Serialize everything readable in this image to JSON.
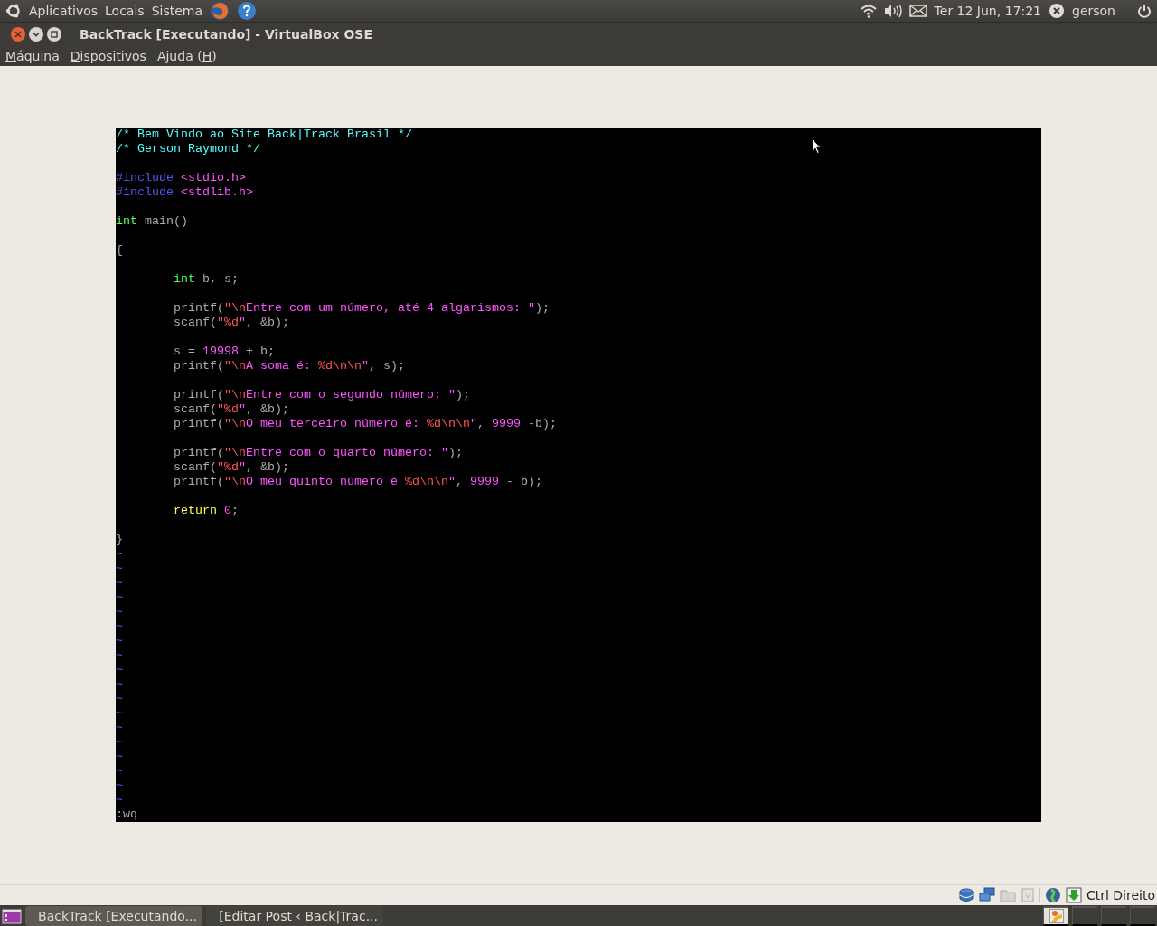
{
  "top_panel": {
    "menus": [
      "Aplicativos",
      "Locais",
      "Sistema"
    ],
    "clock": "Ter 12 Jun, 17:21",
    "user": "gerson"
  },
  "window": {
    "title": "BackTrack [Executando] - VirtualBox OSE"
  },
  "menubar": [
    {
      "mnemonic": "M",
      "rest": "áquina"
    },
    {
      "mnemonic": "D",
      "rest": "ispositivos"
    },
    {
      "before": "Ajuda (",
      "mnemonic": "H",
      "rest": ")"
    }
  ],
  "vm_screen": {
    "lines": [
      {
        "kind": "code",
        "segments": [
          {
            "kind": "comment",
            "text": "/* Bem Vindo ao Site Back|Track Brasil */"
          }
        ]
      },
      {
        "kind": "code",
        "segments": [
          {
            "kind": "comment",
            "text": "/* Gerson Raymond */"
          }
        ]
      },
      {
        "kind": "blank"
      },
      {
        "kind": "code",
        "segments": [
          {
            "kind": "preproc",
            "text": "#include "
          },
          {
            "kind": "string",
            "text": "<stdio.h>"
          }
        ]
      },
      {
        "kind": "code",
        "segments": [
          {
            "kind": "preproc",
            "text": "#include "
          },
          {
            "kind": "string",
            "text": "<stdlib.h>"
          }
        ]
      },
      {
        "kind": "blank"
      },
      {
        "kind": "code",
        "segments": [
          {
            "kind": "type",
            "text": "int"
          },
          {
            "kind": "normal",
            "text": " main()"
          }
        ]
      },
      {
        "kind": "blank"
      },
      {
        "kind": "code",
        "segments": [
          {
            "kind": "normal",
            "text": "{"
          }
        ]
      },
      {
        "kind": "blank"
      },
      {
        "kind": "code",
        "segments": [
          {
            "kind": "type",
            "text": "\tint"
          },
          {
            "kind": "normal",
            "text": " b, s;"
          }
        ]
      },
      {
        "kind": "blank"
      },
      {
        "kind": "code",
        "segments": [
          {
            "kind": "normal",
            "text": "\tprintf("
          },
          {
            "kind": "special",
            "text": "\"\\n"
          },
          {
            "kind": "string",
            "text": "Entre com um número, até 4 algarismos: \""
          },
          {
            "kind": "normal",
            "text": ");"
          }
        ]
      },
      {
        "kind": "code",
        "segments": [
          {
            "kind": "normal",
            "text": "\tscanf("
          },
          {
            "kind": "special",
            "text": "\"%d"
          },
          {
            "kind": "string",
            "text": "\""
          },
          {
            "kind": "normal",
            "text": ", &b);"
          }
        ]
      },
      {
        "kind": "blank"
      },
      {
        "kind": "code",
        "segments": [
          {
            "kind": "normal",
            "text": "\ts = "
          },
          {
            "kind": "string",
            "text": "19998"
          },
          {
            "kind": "normal",
            "text": " + b;"
          }
        ]
      },
      {
        "kind": "code",
        "segments": [
          {
            "kind": "normal",
            "text": "\tprintf("
          },
          {
            "kind": "special",
            "text": "\"\\n"
          },
          {
            "kind": "string",
            "text": "A soma é: "
          },
          {
            "kind": "special",
            "text": "%d\\n\\n"
          },
          {
            "kind": "string",
            "text": "\""
          },
          {
            "kind": "normal",
            "text": ", s);"
          }
        ]
      },
      {
        "kind": "blank"
      },
      {
        "kind": "code",
        "segments": [
          {
            "kind": "normal",
            "text": "\tprintf("
          },
          {
            "kind": "special",
            "text": "\"\\n"
          },
          {
            "kind": "string",
            "text": "Entre com o segundo número: \""
          },
          {
            "kind": "normal",
            "text": ");"
          }
        ]
      },
      {
        "kind": "code",
        "segments": [
          {
            "kind": "normal",
            "text": "\tscanf("
          },
          {
            "kind": "special",
            "text": "\"%d"
          },
          {
            "kind": "string",
            "text": "\""
          },
          {
            "kind": "normal",
            "text": ", &b);"
          }
        ]
      },
      {
        "kind": "code",
        "segments": [
          {
            "kind": "normal",
            "text": "\tprintf("
          },
          {
            "kind": "special",
            "text": "\"\\n"
          },
          {
            "kind": "string",
            "text": "O meu terceiro número é: "
          },
          {
            "kind": "special",
            "text": "%d\\n\\n"
          },
          {
            "kind": "string",
            "text": "\""
          },
          {
            "kind": "normal",
            "text": ", "
          },
          {
            "kind": "string",
            "text": "9999"
          },
          {
            "kind": "normal",
            "text": " -b);"
          }
        ]
      },
      {
        "kind": "blank"
      },
      {
        "kind": "code",
        "segments": [
          {
            "kind": "normal",
            "text": "\tprintf("
          },
          {
            "kind": "special",
            "text": "\"\\n"
          },
          {
            "kind": "string",
            "text": "Entre com o quarto número: \""
          },
          {
            "kind": "normal",
            "text": ");"
          }
        ]
      },
      {
        "kind": "code",
        "segments": [
          {
            "kind": "normal",
            "text": "\tscanf("
          },
          {
            "kind": "special",
            "text": "\"%d"
          },
          {
            "kind": "string",
            "text": "\""
          },
          {
            "kind": "normal",
            "text": ", &b);"
          }
        ]
      },
      {
        "kind": "code",
        "segments": [
          {
            "kind": "normal",
            "text": "\tprintf("
          },
          {
            "kind": "special",
            "text": "\"\\n"
          },
          {
            "kind": "string",
            "text": "O meu quinto número é "
          },
          {
            "kind": "special",
            "text": "%d\\n\\n"
          },
          {
            "kind": "string",
            "text": "\""
          },
          {
            "kind": "normal",
            "text": ", "
          },
          {
            "kind": "string",
            "text": "9999"
          },
          {
            "kind": "normal",
            "text": " - b);"
          }
        ]
      },
      {
        "kind": "blank"
      },
      {
        "kind": "code",
        "segments": [
          {
            "kind": "statement",
            "text": "\treturn"
          },
          {
            "kind": "string",
            "text": " 0"
          },
          {
            "kind": "normal",
            "text": ";"
          }
        ]
      },
      {
        "kind": "blank"
      },
      {
        "kind": "code",
        "segments": [
          {
            "kind": "normal",
            "text": "}"
          }
        ]
      },
      {
        "kind": "tilde",
        "text": "~"
      },
      {
        "kind": "tilde",
        "text": "~"
      },
      {
        "kind": "tilde",
        "text": "~"
      },
      {
        "kind": "tilde",
        "text": "~"
      },
      {
        "kind": "tilde",
        "text": "~"
      },
      {
        "kind": "tilde",
        "text": "~"
      },
      {
        "kind": "tilde",
        "text": "~"
      },
      {
        "kind": "tilde",
        "text": "~"
      },
      {
        "kind": "tilde",
        "text": "~"
      },
      {
        "kind": "tilde",
        "text": "~"
      },
      {
        "kind": "tilde",
        "text": "~"
      },
      {
        "kind": "tilde",
        "text": "~"
      },
      {
        "kind": "tilde",
        "text": "~"
      },
      {
        "kind": "tilde",
        "text": "~"
      },
      {
        "kind": "tilde",
        "text": "~"
      },
      {
        "kind": "tilde",
        "text": "~"
      },
      {
        "kind": "tilde",
        "text": "~"
      },
      {
        "kind": "tilde",
        "text": "~"
      }
    ],
    "command_line": ":wq"
  },
  "status_bar": {
    "host_key": "Ctrl Direito"
  },
  "taskbar": {
    "tasks": [
      {
        "label": "BackTrack [Executando...",
        "selected": true,
        "kind": "vm"
      },
      {
        "label": "[Editar Post ‹ Back|Trac...",
        "selected": false,
        "kind": "browser"
      }
    ]
  }
}
